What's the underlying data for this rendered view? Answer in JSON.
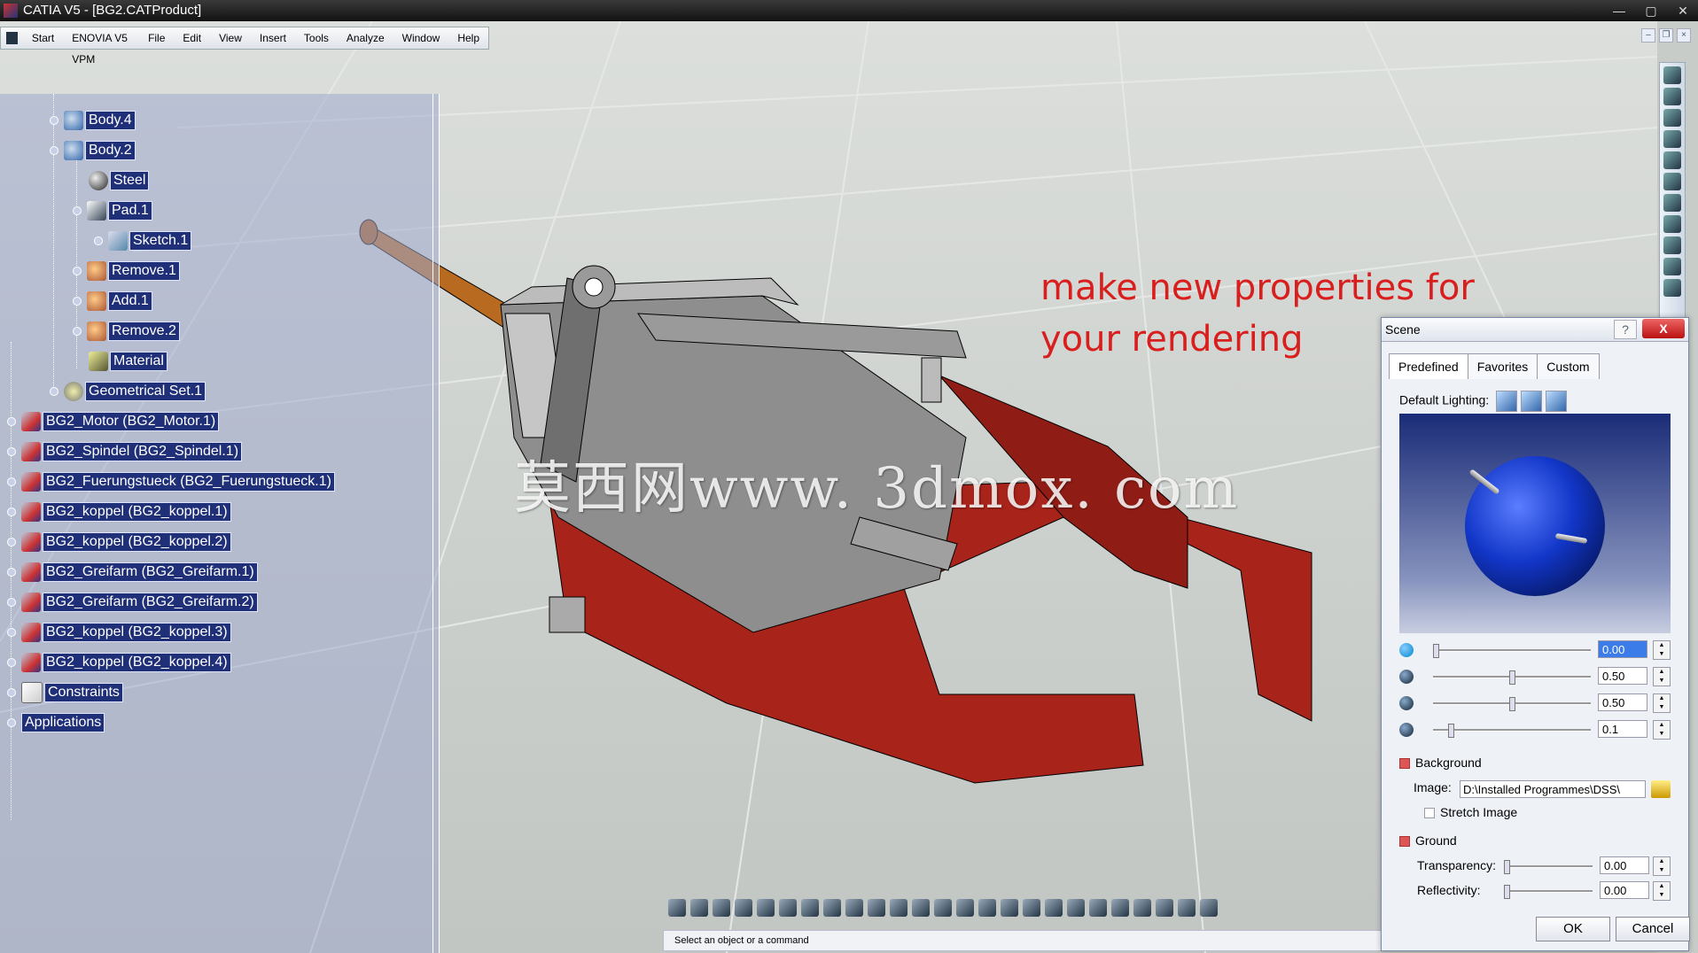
{
  "window": {
    "title": "CATIA V5 - [BG2.CATProduct]",
    "controls": [
      "—",
      "▢",
      "✕"
    ]
  },
  "menu": [
    "Start",
    "ENOVIA V5 VPM",
    "File",
    "Edit",
    "View",
    "Insert",
    "Tools",
    "Analyze",
    "Window",
    "Help"
  ],
  "tree": {
    "items": [
      {
        "label": "Body.4",
        "icon": "body-icon"
      },
      {
        "label": "Body.2",
        "icon": "body-icon"
      },
      {
        "label": "Steel",
        "icon": "material-sphere-icon"
      },
      {
        "label": "Pad.1",
        "icon": "pad-icon"
      },
      {
        "label": "Sketch.1",
        "icon": "sketch-icon"
      },
      {
        "label": "Remove.1",
        "icon": "boolean-icon"
      },
      {
        "label": "Add.1",
        "icon": "boolean-icon"
      },
      {
        "label": "Remove.2",
        "icon": "boolean-icon"
      },
      {
        "label": "Material",
        "icon": "material-icon"
      },
      {
        "label": "Geometrical Set.1",
        "icon": "geometrical-set-icon"
      },
      {
        "label": "BG2_Motor (BG2_Motor.1)",
        "icon": "part-icon"
      },
      {
        "label": "BG2_Spindel (BG2_Spindel.1)",
        "icon": "part-icon"
      },
      {
        "label": "BG2_Fuerungstueck (BG2_Fuerungstueck.1)",
        "icon": "part-icon"
      },
      {
        "label": "BG2_koppel (BG2_koppel.1)",
        "icon": "part-icon"
      },
      {
        "label": "BG2_koppel (BG2_koppel.2)",
        "icon": "part-icon"
      },
      {
        "label": "BG2_Greifarm (BG2_Greifarm.1)",
        "icon": "part-icon"
      },
      {
        "label": "BG2_Greifarm (BG2_Greifarm.2)",
        "icon": "part-icon"
      },
      {
        "label": "BG2_koppel (BG2_koppel.3)",
        "icon": "part-icon"
      },
      {
        "label": "BG2_koppel (BG2_koppel.4)",
        "icon": "part-icon"
      },
      {
        "label": "Constraints",
        "icon": "constraints-icon"
      },
      {
        "label": "Applications",
        "icon": ""
      }
    ]
  },
  "annotation": {
    "line1": "make new properties for",
    "line2": "your rendering"
  },
  "watermark": "莫西网www. 3dmox. com",
  "status": "Select an object or a command",
  "scene_dialog": {
    "title": "Scene",
    "help": "?",
    "close": "X",
    "tabs": [
      "Predefined",
      "Favorites",
      "Custom"
    ],
    "default_lighting_label": "Default Lighting:",
    "sliders": [
      {
        "value": "0.00",
        "level": 0.0
      },
      {
        "value": "0.50",
        "level": 0.5
      },
      {
        "value": "0.50",
        "level": 0.5
      },
      {
        "value": "0.1",
        "level": 0.1
      }
    ],
    "background_label": "Background",
    "image_label": "Image:",
    "image_path": "D:\\Installed Programmes\\DSS\\",
    "stretch_label": "Stretch Image",
    "ground_label": "Ground",
    "transparency_label": "Transparency:",
    "transparency_value": "0.00",
    "transparency_level": 0.0,
    "reflectivity_label": "Reflectivity:",
    "reflectivity_value": "0.00",
    "reflectivity_level": 0.0,
    "ok": "OK",
    "cancel": "Cancel"
  },
  "colors": {
    "tree_label_bg": "#1f2f78",
    "annotation": "#d91e1e",
    "gripper_red": "#a8231a",
    "preview_sphere": "#1236c8"
  }
}
